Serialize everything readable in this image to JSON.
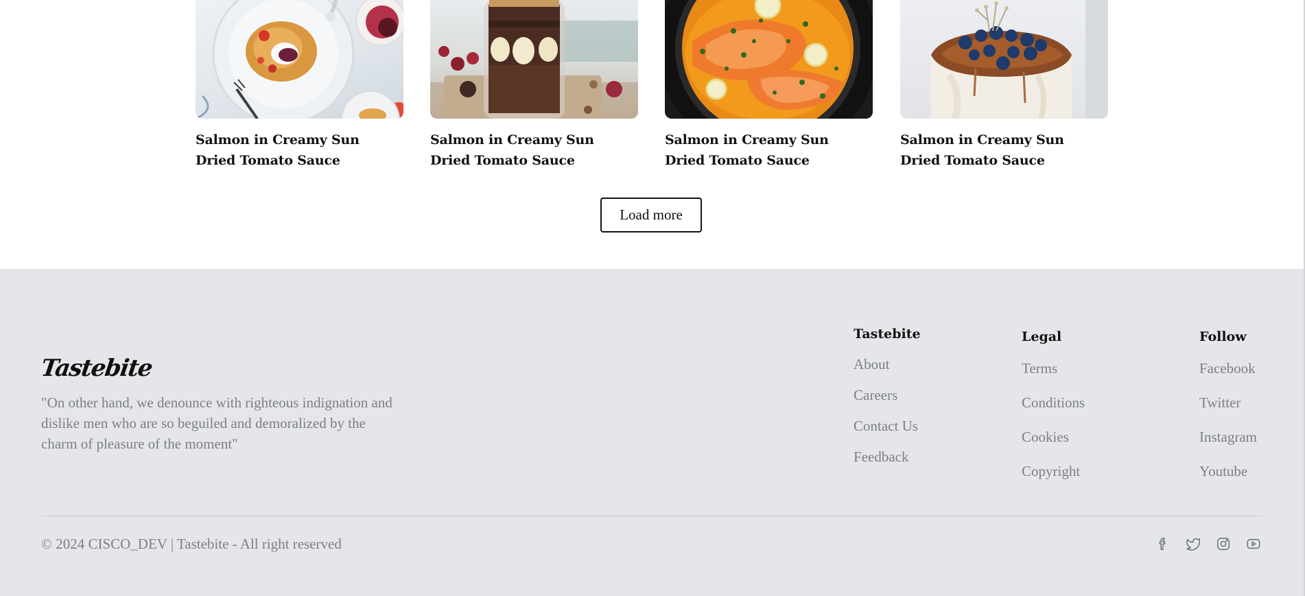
{
  "recipes": [
    {
      "title": "Salmon in Creamy Sun Dried Tomato Sauce",
      "image": "pancakes-with-berries-photo"
    },
    {
      "title": "Salmon in Creamy Sun Dried Tomato Sauce",
      "image": "chocolate-banana-jar-photo"
    },
    {
      "title": "Salmon in Creamy Sun Dried Tomato Sauce",
      "image": "salmon-in-sauce-pan-photo"
    },
    {
      "title": "Salmon in Creamy Sun Dried Tomato Sauce",
      "image": "blueberry-cake-photo"
    }
  ],
  "load_more_label": "Load more",
  "footer": {
    "logo": "Tastebite",
    "quote": "\"On other hand, we denounce with righteous indignation and dislike men who are so beguiled and demoralized by the charm of pleasure of the moment\"",
    "columns": {
      "tastebite": {
        "heading": "Tastebite",
        "links": [
          "About",
          "Careers",
          "Contact Us",
          "Feedback"
        ]
      },
      "legal": {
        "heading": "Legal",
        "links": [
          "Terms",
          "Conditions",
          "Cookies",
          "Copyright"
        ]
      },
      "follow": {
        "heading": "Follow",
        "links": [
          "Facebook",
          "Twitter",
          "Instagram",
          "Youtube"
        ]
      }
    },
    "copyright": "© 2024 CISCO_DEV | Tastebite - All right reserved",
    "social_icons": [
      "facebook-icon",
      "twitter-icon",
      "instagram-icon",
      "youtube-icon"
    ],
    "colors": {
      "background": "#e5e6e9",
      "muted_text": "#7c7f86",
      "heading": "#111111"
    }
  }
}
